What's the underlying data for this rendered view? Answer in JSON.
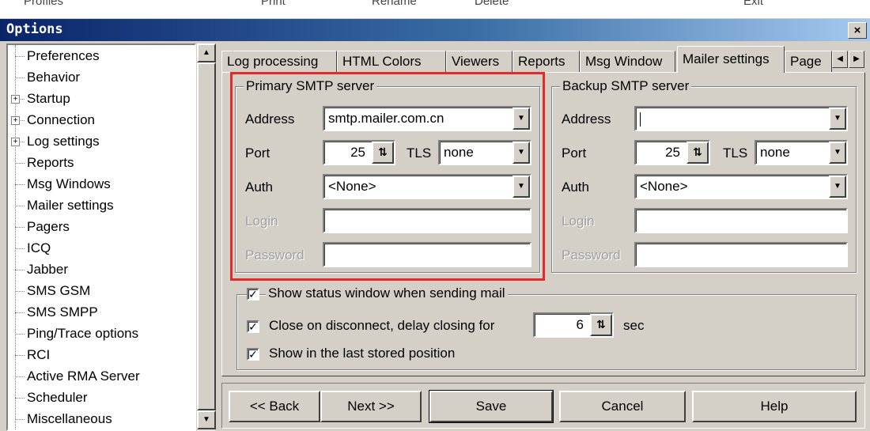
{
  "background_strip": [
    "Profiles",
    "Print",
    "Rename",
    "Delete",
    "Exit"
  ],
  "window": {
    "title": "Options",
    "close_glyph": "×"
  },
  "tree": {
    "items": [
      {
        "label": "Preferences",
        "expandable": false
      },
      {
        "label": "Behavior",
        "expandable": false
      },
      {
        "label": "Startup",
        "expandable": true
      },
      {
        "label": "Connection",
        "expandable": true
      },
      {
        "label": "Log settings",
        "expandable": true
      },
      {
        "label": "Reports",
        "expandable": false
      },
      {
        "label": "Msg Windows",
        "expandable": false
      },
      {
        "label": "Mailer settings",
        "expandable": false
      },
      {
        "label": "Pagers",
        "expandable": false
      },
      {
        "label": "ICQ",
        "expandable": false
      },
      {
        "label": "Jabber",
        "expandable": false
      },
      {
        "label": "SMS GSM",
        "expandable": false
      },
      {
        "label": "SMS SMPP",
        "expandable": false
      },
      {
        "label": "Ping/Trace options",
        "expandable": false
      },
      {
        "label": "RCI",
        "expandable": false
      },
      {
        "label": "Active RMA Server",
        "expandable": false
      },
      {
        "label": "Scheduler",
        "expandable": false
      },
      {
        "label": "Miscellaneous",
        "expandable": false
      }
    ]
  },
  "tabs": [
    "Log processing",
    "HTML Colors",
    "Viewers",
    "Reports",
    "Msg Window",
    "Mailer settings",
    "Page"
  ],
  "active_tab": "Mailer settings",
  "primary_smtp": {
    "legend": "Primary SMTP server",
    "address_label": "Address",
    "address_value": "smtp.mailer.com.cn",
    "port_label": "Port",
    "port_value": "25",
    "tls_label": "TLS",
    "tls_value": "none",
    "auth_label": "Auth",
    "auth_value": "<None>",
    "login_label": "Login",
    "login_value": "",
    "password_label": "Password",
    "password_value": ""
  },
  "backup_smtp": {
    "legend": "Backup SMTP server",
    "address_label": "Address",
    "address_value": "",
    "port_label": "Port",
    "port_value": "25",
    "tls_label": "TLS",
    "tls_value": "none",
    "auth_label": "Auth",
    "auth_value": "<None>",
    "login_label": "Login",
    "login_value": "",
    "password_label": "Password",
    "password_value": ""
  },
  "status_options": {
    "show_status_label": "Show status window when sending mail",
    "close_on_disconnect_label": "Close on disconnect, delay closing for",
    "delay_value": "6",
    "delay_unit": "sec",
    "last_position_label": "Show in the last stored position",
    "show_status_checked": true,
    "close_on_disconnect_checked": true,
    "last_position_checked": true
  },
  "buttons": {
    "back": "<< Back",
    "next": "Next >>",
    "save": "Save",
    "cancel": "Cancel",
    "help": "Help"
  },
  "glyphs": {
    "check": "✓",
    "dropdown": "▼",
    "spin": "⇅",
    "scroll_up": "▲",
    "scroll_down": "▼",
    "tab_left": "◀",
    "tab_right": "▶",
    "plus": "+"
  },
  "colors": {
    "highlight_box": "#e62a2a",
    "title_start": "#0a246a",
    "title_end": "#a6caf0",
    "face": "#d4d0c8"
  }
}
